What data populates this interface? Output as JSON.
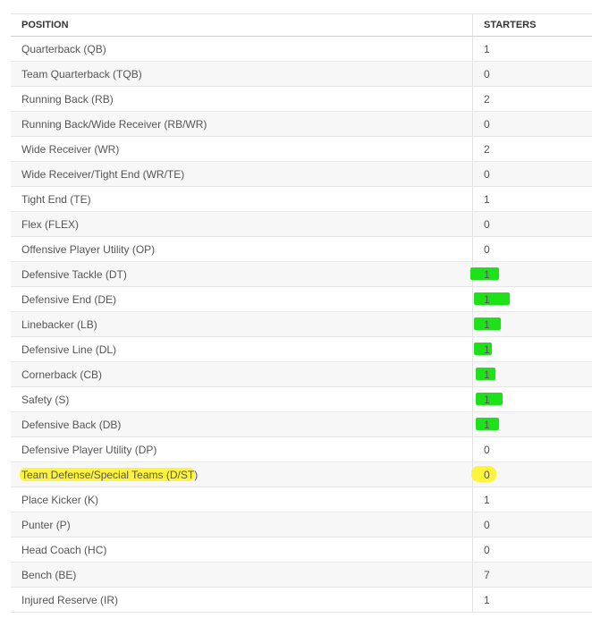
{
  "table": {
    "headers": {
      "position": "POSITION",
      "starters": "STARTERS"
    },
    "rows": [
      {
        "position": "Quarterback (QB)",
        "starters": "1"
      },
      {
        "position": "Team Quarterback (TQB)",
        "starters": "0"
      },
      {
        "position": "Running Back (RB)",
        "starters": "2"
      },
      {
        "position": "Running Back/Wide Receiver (RB/WR)",
        "starters": "0"
      },
      {
        "position": "Wide Receiver (WR)",
        "starters": "2"
      },
      {
        "position": "Wide Receiver/Tight End (WR/TE)",
        "starters": "0"
      },
      {
        "position": "Tight End (TE)",
        "starters": "1"
      },
      {
        "position": "Flex (FLEX)",
        "starters": "0"
      },
      {
        "position": "Offensive Player Utility (OP)",
        "starters": "0"
      },
      {
        "position": "Defensive Tackle (DT)",
        "starters": "1"
      },
      {
        "position": "Defensive End (DE)",
        "starters": "1"
      },
      {
        "position": "Linebacker (LB)",
        "starters": "1"
      },
      {
        "position": "Defensive Line (DL)",
        "starters": "1"
      },
      {
        "position": "Cornerback (CB)",
        "starters": "1"
      },
      {
        "position": "Safety (S)",
        "starters": "1"
      },
      {
        "position": "Defensive Back (DB)",
        "starters": "1"
      },
      {
        "position": "Defensive Player Utility (DP)",
        "starters": "0"
      },
      {
        "position": "Team Defense/Special Teams (D/ST)",
        "starters": "0"
      },
      {
        "position": "Place Kicker (K)",
        "starters": "1"
      },
      {
        "position": "Punter (P)",
        "starters": "0"
      },
      {
        "position": "Head Coach (HC)",
        "starters": "0"
      },
      {
        "position": "Bench (BE)",
        "starters": "7"
      },
      {
        "position": "Injured Reserve (IR)",
        "starters": "1"
      }
    ]
  },
  "colors": {
    "green_highlight": "#1de21a",
    "yellow_highlight": "#fff333"
  }
}
